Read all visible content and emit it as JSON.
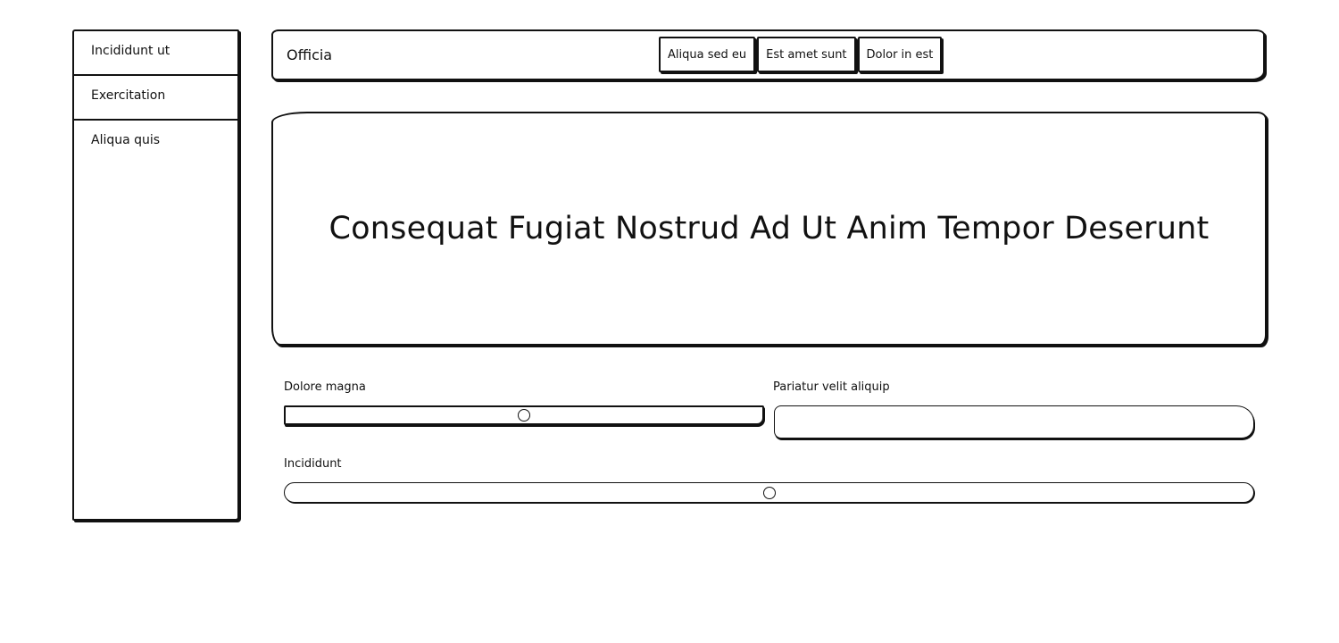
{
  "sidebar": {
    "items": [
      {
        "label": "Incididunt ut"
      },
      {
        "label": "Exercitation"
      },
      {
        "label": "Aliqua quis"
      }
    ]
  },
  "header": {
    "title": "Officia",
    "tabs": [
      {
        "label": "Aliqua sed eu"
      },
      {
        "label": "Est amet sunt"
      },
      {
        "label": "Dolor in est"
      }
    ]
  },
  "hero": {
    "title": "Consequat Fugiat Nostrud Ad Ut Anim Tempor Deserunt"
  },
  "form": {
    "slider_a": {
      "label": "Dolore magna",
      "value_percent": 50
    },
    "text_input": {
      "label": "Pariatur velit aliquip",
      "value": ""
    },
    "slider_c": {
      "label": "Incididunt",
      "value_percent": 50
    }
  }
}
